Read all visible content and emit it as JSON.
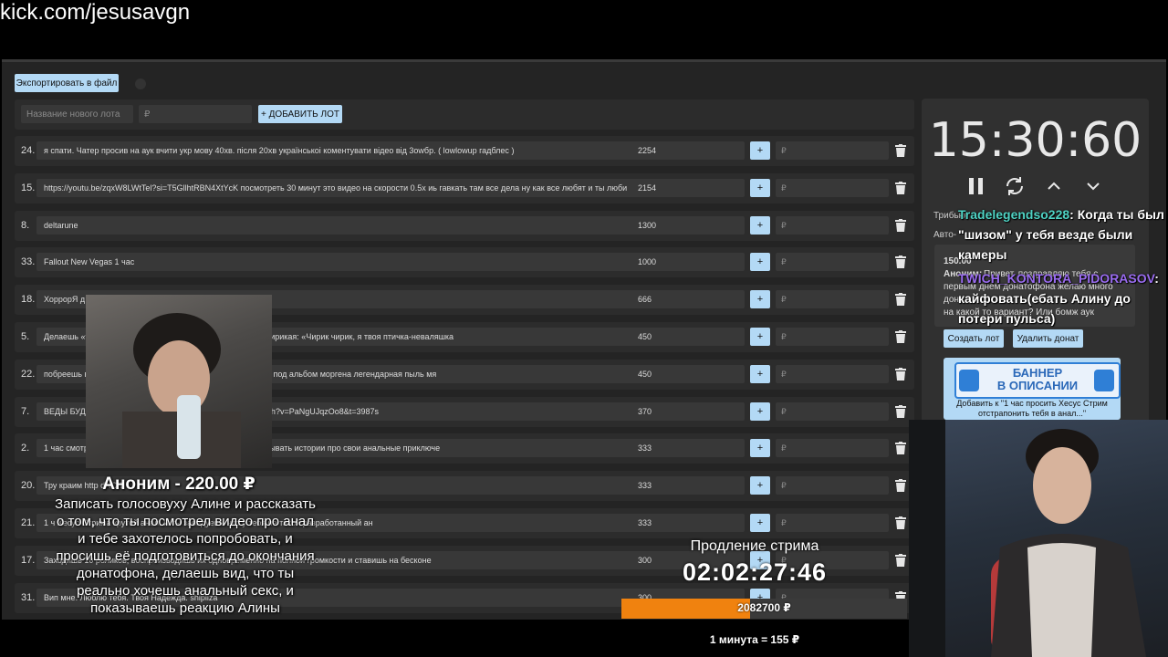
{
  "stream_url": "kick.com/jesusavgn",
  "toolbar": {
    "export_label": "Экспортировать в файл"
  },
  "new_lot": {
    "name_placeholder": "Название нового лота",
    "amount_placeholder": "₽",
    "add_label": "+ ДОБАВИТЬ ЛОТ"
  },
  "lots": [
    {
      "num": "24.",
      "name": "я спати. Чатер просив на аук вчити укр мову 40хв. після 20хв українськоі коментувати відео від 3оwбр. ( lowlowup гадблес )",
      "amount": "2254",
      "plus": "+",
      "rub": "₽"
    },
    {
      "num": "15.",
      "name": "https://youtu.be/zqxW8LWtTel?si=T5GllhtRBN4XtYcK посмотреть 30 минут это видео на скорости 0.5х иь гавкать там все дела ну как все любят и ты люби",
      "amount": "2154",
      "plus": "+",
      "rub": "₽"
    },
    {
      "num": "8.",
      "name": "deltarune",
      "amount": "1300",
      "plus": "+",
      "rub": "₽"
    },
    {
      "num": "33.",
      "name": "Fallout New Vegas 1 час",
      "amount": "1000",
      "plus": "+",
      "rub": "₽"
    },
    {
      "num": "18.",
      "name": "ХоррорЯ д",
      "amount": "666",
      "plus": "+",
      "rub": "₽"
    },
    {
      "num": "5.",
      "name": "Делаешь «т                                    летаешь» вокруг камеры прыжками на месте чирикая: «Чирик чирик, я твоя птичка-неваляшка",
      "amount": "450",
      "plus": "+",
      "rub": "₽"
    },
    {
      "num": "22.",
      "name": "побреешь                                         в клеш рояль поиграй пол часика клеш рояльчик под альбом моргена легендарная пыль мя",
      "amount": "450",
      "plus": "+",
      "rub": "₽"
    },
    {
      "num": "7.",
      "name": "ВЕДЫ БУДЕ                                        ДЫ ВЕДЫ ВЕДЫ https://www.youtube.com/watch?v=PaNgUJqzOo8&t=3987s",
      "amount": "370",
      "plus": "+",
      "rub": "₽"
    },
    {
      "num": "2.",
      "name": "1 час смотре                                     ще 30 секунд. И соглашаться со всем. Выдумывать истории про свои анальные приключе",
      "amount": "333",
      "plus": "+",
      "rub": "₽"
    },
    {
      "num": "20.",
      "name": "Тру краим http                                  dRClT",
      "amount": "333",
      "plus": "+",
      "rub": "₽"
    },
    {
      "num": "21.",
      "name": "1 ч                                                    Хесус Стрима крутой анал. И ты завидуешь что у тебя не такой разработанный ан",
      "amount": "333",
      "plus": "+",
      "rub": "₽"
    },
    {
      "num": "17.",
      "name": "Заходишь                                            10 роликов, воспроизводишь их одновременно на полной громкости и ставишь на бесконе",
      "amount": "300",
      "plus": "+",
      "rub": "₽"
    },
    {
      "num": "31.",
      "name": "Вип мне. Люблю тебя. Твоя Надежда. shipliza",
      "amount": "300",
      "plus": "+",
      "rub": "₽"
    }
  ],
  "side": {
    "timer": "15:30:60",
    "label_tribute": "Трибьют",
    "label_auto": "Авто-",
    "donation_amount": "150.00",
    "donation_author": "Аноним:",
    "donation_text_1": "Привет, поздравляю тебя с",
    "donation_text_2": "первым днем донатофона желаю много",
    "donation_text_3": "дон",
    "donation_text_4": "на какой то вариант? Или бомж аук",
    "create_lot_label": "Создать лот",
    "delete_donation_label": "Удалить донат",
    "add_to_label": "Добавить к \"1 час просить Хесус Стрим отстрапонить тебя в анал...\""
  },
  "banner": {
    "line1": "БАННЕР",
    "line2": "В ОПИСАНИИ"
  },
  "chat": [
    {
      "nick": "Tradelegendso228",
      "text": ": Когда ты был \"шизом\" у тебя везде были камеры",
      "color": "#4fd3c4"
    },
    {
      "nick": "TWICH_KONTORA_PIDORASOV",
      "text": ": кайфовать(ебать Алину до потери пульса)",
      "color": "#9a6cf0"
    }
  ],
  "alert": {
    "title": "Аноним - 220.00 ₽",
    "message": "Записать голосовуху Алине и рассказать о том, что ты посмотрел видео про анал и тебе захотелось попробовать, и просишь её подготовиться до окончания донатофона, делаешь вид, что ты реально хочешь анальный секс, и показываешь реакцию Алины"
  },
  "extension": {
    "label": "Продление стрима",
    "timer": "02:02:27:46",
    "progress_text": "2082700 ₽",
    "progress_fraction": 0.45,
    "rate": "1 минута = 155 ₽"
  },
  "colors": {
    "accent": "#b3d9f5",
    "progress": "#f0820f",
    "panel": "#242424"
  }
}
